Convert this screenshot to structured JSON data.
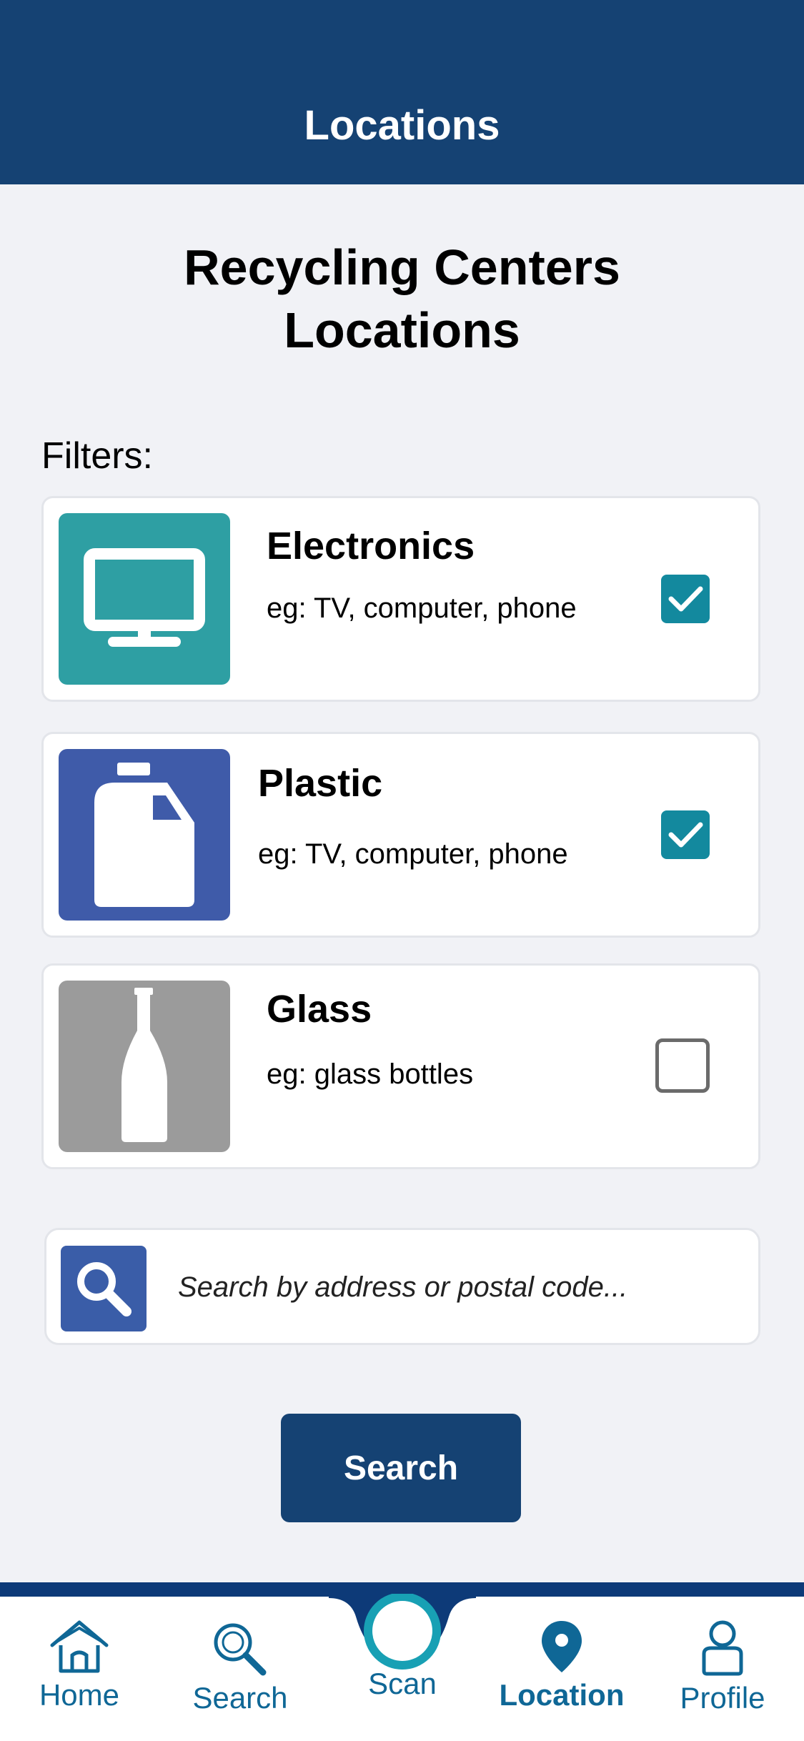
{
  "header": {
    "title": "Locations"
  },
  "main": {
    "title_line1": "Recycling Centers",
    "title_line2": "Locations",
    "filters_label": "Filters:"
  },
  "filters": [
    {
      "title": "Electronics",
      "description": "eg: TV, computer, phone",
      "checked": true,
      "icon": "monitor-icon",
      "color": "#2e9fa3"
    },
    {
      "title": "Plastic",
      "description": "eg: TV, computer, phone",
      "checked": true,
      "icon": "plastic-jug-icon",
      "color": "#3f5ba9"
    },
    {
      "title": "Glass",
      "description": "eg: glass bottles",
      "checked": false,
      "icon": "glass-bottle-icon",
      "color": "#9b9b9b"
    }
  ],
  "search": {
    "placeholder": "Search by address or postal code...",
    "value": "",
    "button_label": "Search"
  },
  "nav": {
    "items": [
      {
        "label": "Home",
        "icon": "home-icon"
      },
      {
        "label": "Search",
        "icon": "search-icon"
      },
      {
        "label": "Scan",
        "icon": "scan-icon"
      },
      {
        "label": "Location",
        "icon": "location-pin-icon",
        "active": true
      },
      {
        "label": "Profile",
        "icon": "profile-icon"
      }
    ]
  },
  "colors": {
    "primary": "#154273",
    "accent": "#13899e",
    "nav": "#0f6796"
  }
}
